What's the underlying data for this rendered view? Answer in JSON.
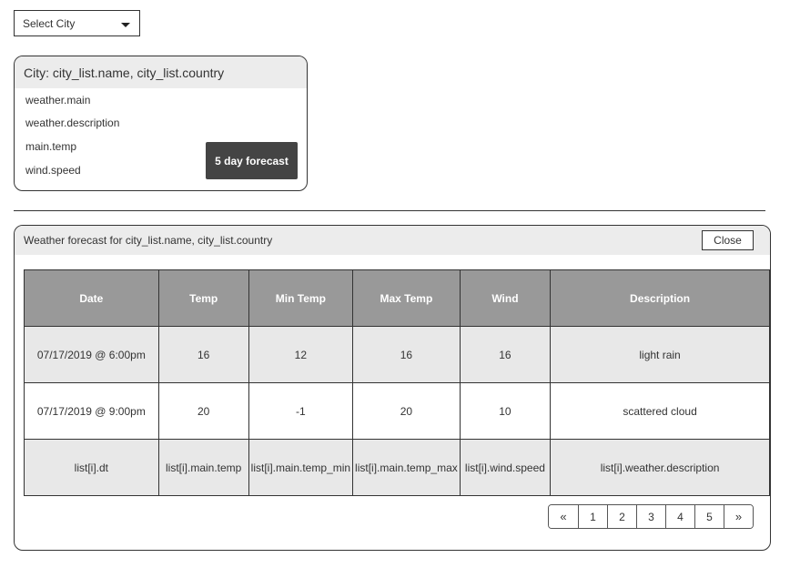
{
  "city_select": {
    "label": "Select City"
  },
  "city_card": {
    "title": "City: city_list.name,  city_list.country",
    "fields": [
      "weather.main",
      "weather.description",
      "main.temp",
      "wind.speed"
    ],
    "forecast_button": "5 day forecast"
  },
  "forecast_panel": {
    "title": "Weather forecast for city_list.name, city_list.country",
    "close_label": "Close",
    "table": {
      "headers": [
        "Date",
        "Temp",
        "Min Temp",
        "Max Temp",
        "Wind",
        "Description"
      ],
      "rows": [
        [
          "07/17/2019 @ 6:00pm",
          "16",
          "12",
          "16",
          "16",
          "light rain"
        ],
        [
          "07/17/2019 @ 9:00pm",
          "20",
          "-1",
          "20",
          "10",
          "scattered cloud"
        ],
        [
          "list[i].dt",
          "list[i].main.temp",
          "list[i].main.temp_min",
          "list[i].main.temp_max",
          "list[i].wind.speed",
          "list[i].weather.description"
        ]
      ]
    },
    "pagination": {
      "prev": "«",
      "pages": [
        "1",
        "2",
        "3",
        "4",
        "5"
      ],
      "next": "»"
    }
  },
  "colors": {
    "header_bg": "#ececec",
    "table_header": "#999999",
    "button": "#444444",
    "row_alt": "#e8e8e8"
  }
}
